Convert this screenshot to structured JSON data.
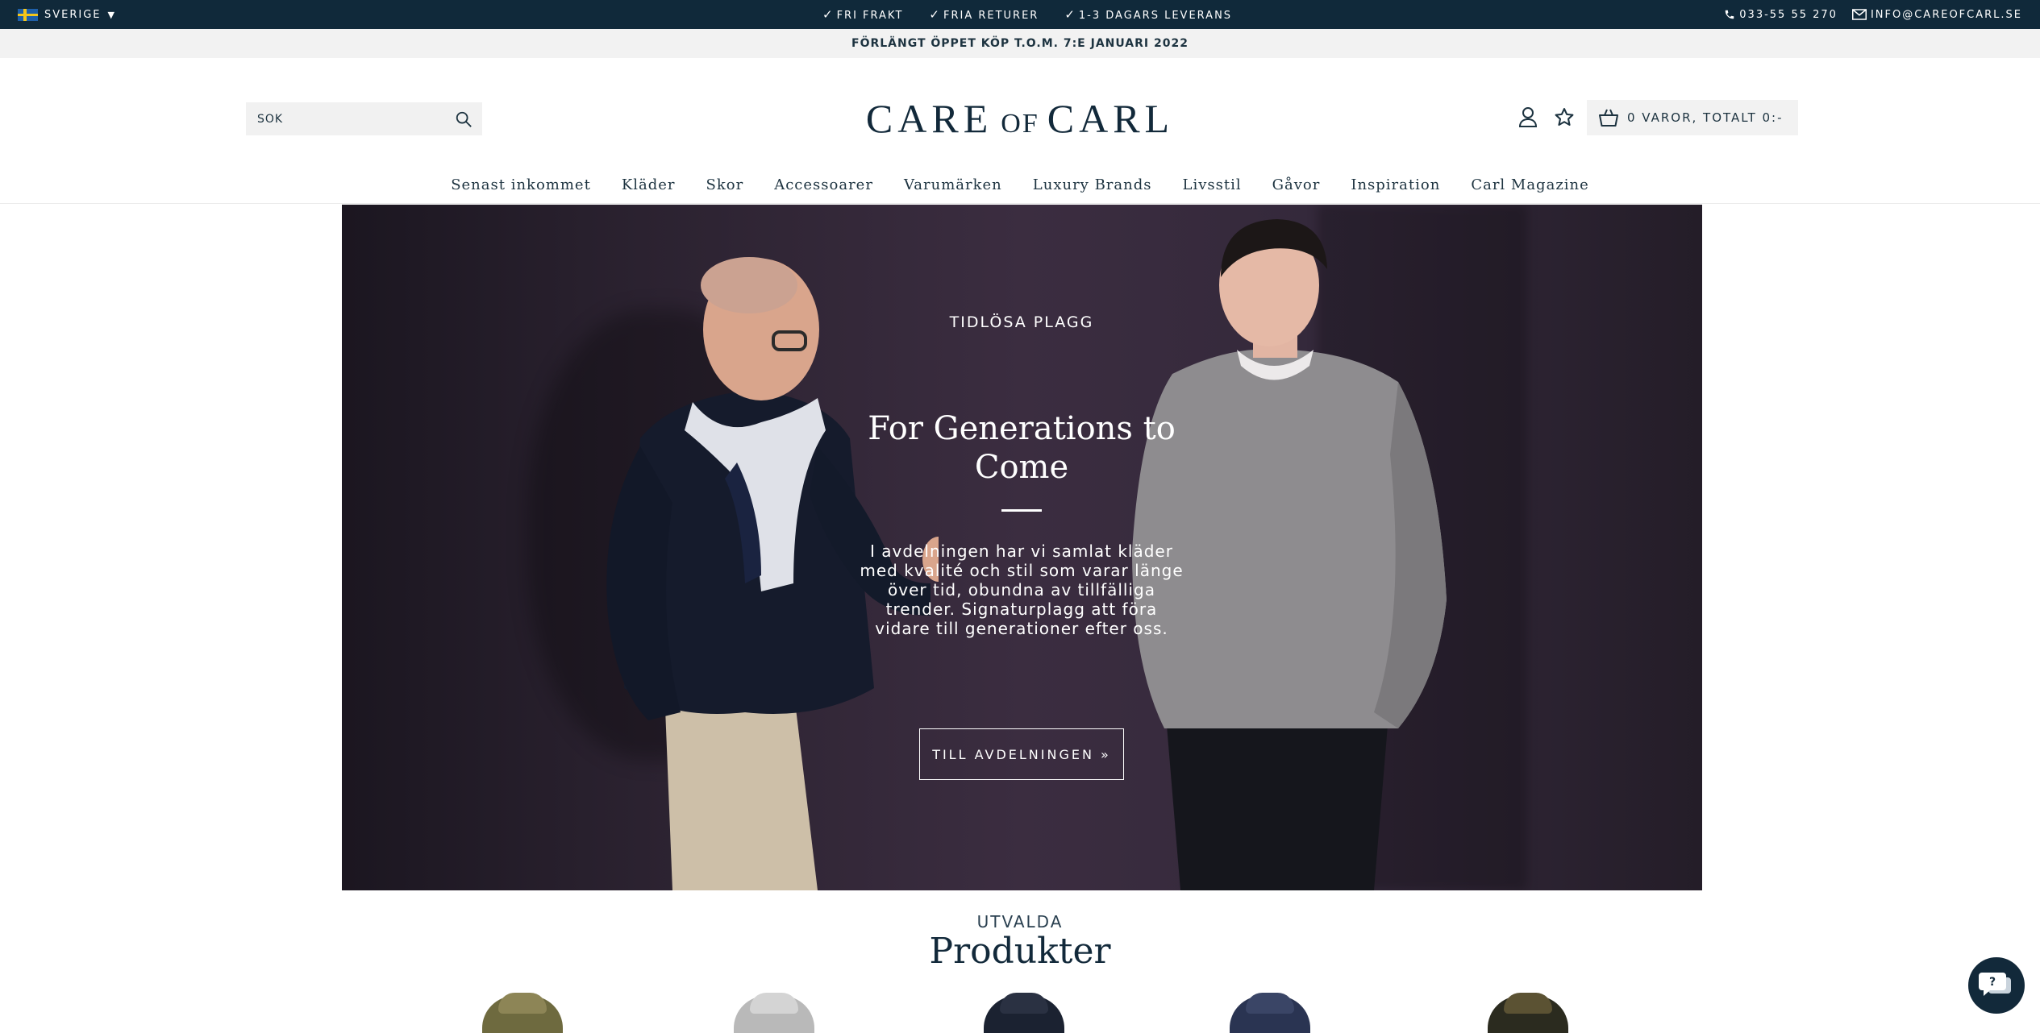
{
  "topbar": {
    "country": "SVERIGE",
    "usps": [
      "FRI FRAKT",
      "FRIA RETURER",
      "1-3 DAGARS LEVERANS"
    ],
    "phone": "033-55 55 270",
    "email": "INFO@CAREOFCARL.SE"
  },
  "announcement": "FÖRLÄNGT ÖPPET KÖP T.O.M. 7:E JANUARI 2022",
  "header": {
    "search_placeholder": "SÖK",
    "logo": {
      "part1": "CARE",
      "part2": "OF",
      "part3": "CARL"
    },
    "cart_label": "0 VAROR, TOTALT 0:-"
  },
  "nav": [
    "Senast inkommet",
    "Kläder",
    "Skor",
    "Accessoarer",
    "Varumärken",
    "Luxury Brands",
    "Livsstil",
    "Gåvor",
    "Inspiration",
    "Carl Magazine"
  ],
  "hero": {
    "kicker": "TIDLÖSA PLAGG",
    "headline": "For Generations to Come",
    "body": "I avdelningen har vi samlat kläder med kvalité och stil som varar länge över tid, obundna av tillfälliga trender. Signaturplagg att föra vidare till generationer efter oss.",
    "cta": "TILL AVDELNINGEN »"
  },
  "featured": {
    "kicker": "UTVALDA",
    "title": "Produkter"
  },
  "colors": {
    "topbar_bg": "#10293a",
    "brand_navy": "#12293a",
    "announce_bg": "#f2f2f2"
  }
}
